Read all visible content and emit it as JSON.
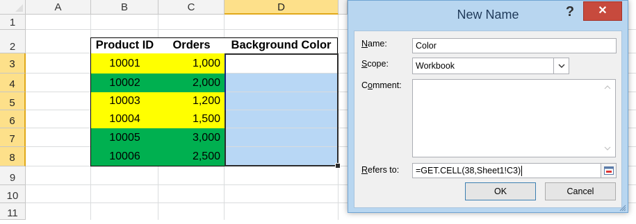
{
  "columns": [
    "A",
    "B",
    "C",
    "D"
  ],
  "rows": [
    "1",
    "2",
    "3",
    "4",
    "5",
    "6",
    "7",
    "8",
    "9",
    "10",
    "11"
  ],
  "table": {
    "headers": [
      "Product ID",
      "Orders",
      "Background Color"
    ],
    "rows": [
      {
        "id": "10001",
        "orders": "1,000",
        "color": "yellow"
      },
      {
        "id": "10002",
        "orders": "2,000",
        "color": "green"
      },
      {
        "id": "10003",
        "orders": "1,200",
        "color": "yellow"
      },
      {
        "id": "10004",
        "orders": "1,500",
        "color": "yellow"
      },
      {
        "id": "10005",
        "orders": "3,000",
        "color": "green"
      },
      {
        "id": "10006",
        "orders": "2,500",
        "color": "green"
      }
    ]
  },
  "colors": {
    "yellow": "#ffff00",
    "green": "#00b050",
    "selection": "#b8d7f5",
    "header_selected": "#fde08a",
    "dialog_chrome": "#b8d6f0",
    "close_button": "#c74a3d"
  },
  "dialog": {
    "title": "New Name",
    "help_icon": "?",
    "close_icon": "✕",
    "name_label_u": "N",
    "name_label_rest": "ame:",
    "name_value": "Color",
    "scope_label_u": "S",
    "scope_label_rest": "cope:",
    "scope_value": "Workbook",
    "comment_label_pre": "C",
    "comment_label_u": "o",
    "comment_label_rest": "mment:",
    "refers_label_u": "R",
    "refers_label_rest": "efers to:",
    "refers_value": "=GET.CELL(38,Sheet1!C3)",
    "ok_label": "OK",
    "cancel_label": "Cancel"
  }
}
